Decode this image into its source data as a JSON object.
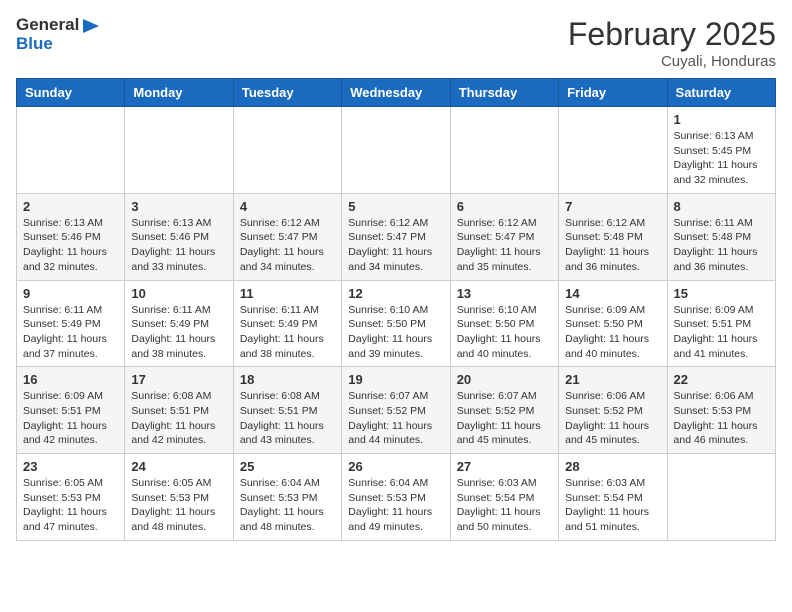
{
  "header": {
    "logo_general": "General",
    "logo_blue": "Blue",
    "month_title": "February 2025",
    "location": "Cuyali, Honduras"
  },
  "weekdays": [
    "Sunday",
    "Monday",
    "Tuesday",
    "Wednesday",
    "Thursday",
    "Friday",
    "Saturday"
  ],
  "weeks": [
    [
      {
        "day": "",
        "info": ""
      },
      {
        "day": "",
        "info": ""
      },
      {
        "day": "",
        "info": ""
      },
      {
        "day": "",
        "info": ""
      },
      {
        "day": "",
        "info": ""
      },
      {
        "day": "",
        "info": ""
      },
      {
        "day": "1",
        "info": "Sunrise: 6:13 AM\nSunset: 5:45 PM\nDaylight: 11 hours and 32 minutes."
      }
    ],
    [
      {
        "day": "2",
        "info": "Sunrise: 6:13 AM\nSunset: 5:46 PM\nDaylight: 11 hours and 32 minutes."
      },
      {
        "day": "3",
        "info": "Sunrise: 6:13 AM\nSunset: 5:46 PM\nDaylight: 11 hours and 33 minutes."
      },
      {
        "day": "4",
        "info": "Sunrise: 6:12 AM\nSunset: 5:47 PM\nDaylight: 11 hours and 34 minutes."
      },
      {
        "day": "5",
        "info": "Sunrise: 6:12 AM\nSunset: 5:47 PM\nDaylight: 11 hours and 34 minutes."
      },
      {
        "day": "6",
        "info": "Sunrise: 6:12 AM\nSunset: 5:47 PM\nDaylight: 11 hours and 35 minutes."
      },
      {
        "day": "7",
        "info": "Sunrise: 6:12 AM\nSunset: 5:48 PM\nDaylight: 11 hours and 36 minutes."
      },
      {
        "day": "8",
        "info": "Sunrise: 6:11 AM\nSunset: 5:48 PM\nDaylight: 11 hours and 36 minutes."
      }
    ],
    [
      {
        "day": "9",
        "info": "Sunrise: 6:11 AM\nSunset: 5:49 PM\nDaylight: 11 hours and 37 minutes."
      },
      {
        "day": "10",
        "info": "Sunrise: 6:11 AM\nSunset: 5:49 PM\nDaylight: 11 hours and 38 minutes."
      },
      {
        "day": "11",
        "info": "Sunrise: 6:11 AM\nSunset: 5:49 PM\nDaylight: 11 hours and 38 minutes."
      },
      {
        "day": "12",
        "info": "Sunrise: 6:10 AM\nSunset: 5:50 PM\nDaylight: 11 hours and 39 minutes."
      },
      {
        "day": "13",
        "info": "Sunrise: 6:10 AM\nSunset: 5:50 PM\nDaylight: 11 hours and 40 minutes."
      },
      {
        "day": "14",
        "info": "Sunrise: 6:09 AM\nSunset: 5:50 PM\nDaylight: 11 hours and 40 minutes."
      },
      {
        "day": "15",
        "info": "Sunrise: 6:09 AM\nSunset: 5:51 PM\nDaylight: 11 hours and 41 minutes."
      }
    ],
    [
      {
        "day": "16",
        "info": "Sunrise: 6:09 AM\nSunset: 5:51 PM\nDaylight: 11 hours and 42 minutes."
      },
      {
        "day": "17",
        "info": "Sunrise: 6:08 AM\nSunset: 5:51 PM\nDaylight: 11 hours and 42 minutes."
      },
      {
        "day": "18",
        "info": "Sunrise: 6:08 AM\nSunset: 5:51 PM\nDaylight: 11 hours and 43 minutes."
      },
      {
        "day": "19",
        "info": "Sunrise: 6:07 AM\nSunset: 5:52 PM\nDaylight: 11 hours and 44 minutes."
      },
      {
        "day": "20",
        "info": "Sunrise: 6:07 AM\nSunset: 5:52 PM\nDaylight: 11 hours and 45 minutes."
      },
      {
        "day": "21",
        "info": "Sunrise: 6:06 AM\nSunset: 5:52 PM\nDaylight: 11 hours and 45 minutes."
      },
      {
        "day": "22",
        "info": "Sunrise: 6:06 AM\nSunset: 5:53 PM\nDaylight: 11 hours and 46 minutes."
      }
    ],
    [
      {
        "day": "23",
        "info": "Sunrise: 6:05 AM\nSunset: 5:53 PM\nDaylight: 11 hours and 47 minutes."
      },
      {
        "day": "24",
        "info": "Sunrise: 6:05 AM\nSunset: 5:53 PM\nDaylight: 11 hours and 48 minutes."
      },
      {
        "day": "25",
        "info": "Sunrise: 6:04 AM\nSunset: 5:53 PM\nDaylight: 11 hours and 48 minutes."
      },
      {
        "day": "26",
        "info": "Sunrise: 6:04 AM\nSunset: 5:53 PM\nDaylight: 11 hours and 49 minutes."
      },
      {
        "day": "27",
        "info": "Sunrise: 6:03 AM\nSunset: 5:54 PM\nDaylight: 11 hours and 50 minutes."
      },
      {
        "day": "28",
        "info": "Sunrise: 6:03 AM\nSunset: 5:54 PM\nDaylight: 11 hours and 51 minutes."
      },
      {
        "day": "",
        "info": ""
      }
    ]
  ]
}
